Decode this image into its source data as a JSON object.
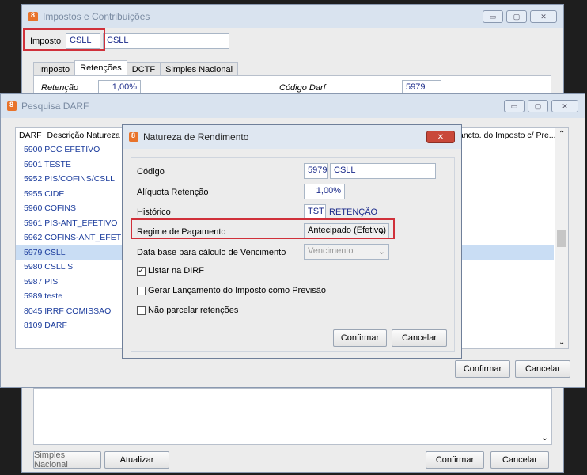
{
  "impostos_window": {
    "title": "Impostos e Contribuições",
    "imposto_label": "Imposto",
    "imposto_code": "CSLL",
    "imposto_name": "CSLL",
    "tabs": [
      "Imposto",
      "Retenções",
      "DCTF",
      "Simples Nacional"
    ],
    "retencao_label": "Retenção",
    "retencao_value": "1,00%",
    "codigo_darf_label": "Código Darf",
    "codigo_darf_value": "5979",
    "simples_button": "Simples Nacional",
    "atualizar_button": "Atualizar",
    "confirmar_button": "Confirmar",
    "cancelar_button": "Cancelar"
  },
  "pesquisa_window": {
    "title": "Pesquisa DARF",
    "col_darf": "DARF",
    "col_descricao": "Descrição Natureza",
    "col_lancto": "ancto. do Imposto c/ Pre...",
    "rows": [
      "5900 PCC EFETIVO",
      "5901 TESTE",
      "5952 PIS/COFINS/CSLL",
      "5955 CIDE",
      "5960 COFINS",
      "5961 PIS-ANT_EFETIVO",
      "5962 COFINS-ANT_EFETIVO",
      "5979 CSLL",
      "5980 CSLL S",
      "5987 PIS",
      "5989 teste",
      "8045 IRRF COMISSAO",
      "8109 DARF"
    ],
    "selected_row": "5979 CSLL",
    "confirmar_button": "Confirmar",
    "cancelar_button": "Cancelar"
  },
  "natureza_dialog": {
    "title": "Natureza de Rendimento",
    "close_icon": "close-icon",
    "codigo_label": "Código",
    "codigo_value": "5979",
    "codigo_desc": "CSLL",
    "aliquota_label": "Alíquota Retenção",
    "aliquota_value": "1,00%",
    "historico_label": "Histórico",
    "historico_value": "TST",
    "historico_desc": "RETENÇÃO",
    "regime_label": "Regime de Pagamento",
    "regime_value": "Antecipado (Efetivo)",
    "database_label": "Data base para cálculo de Vencimento",
    "database_value": "Vencimento",
    "listar_dirf": "Listar na DIRF",
    "listar_dirf_checked": true,
    "gerar_lancamento": "Gerar Lançamento do Imposto como Previsão",
    "gerar_lancamento_checked": false,
    "nao_parcelar": "Não parcelar retenções",
    "nao_parcelar_checked": false,
    "confirmar_button": "Confirmar",
    "cancelar_button": "Cancelar"
  },
  "colors": {
    "highlight_red": "#d0303a",
    "selection": "#c9ddf4",
    "link_blue": "#1a3b9c"
  }
}
